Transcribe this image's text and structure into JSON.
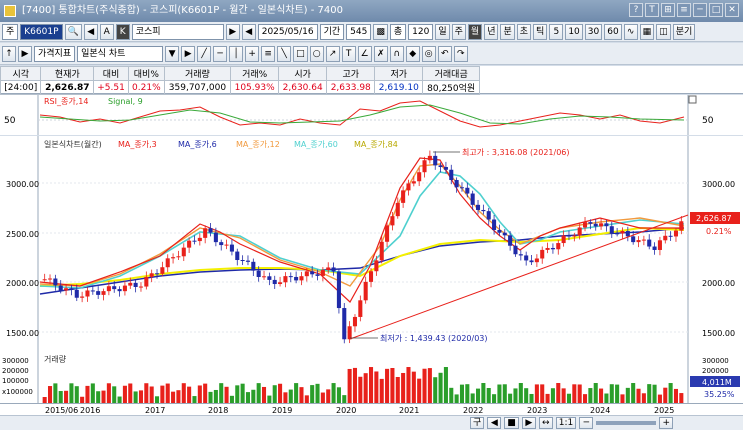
{
  "window": {
    "title": "[7400] 통합차트(주식종합) - 코스피(K6601P - 월간 - 일본식차트) - 7400",
    "buttons": [
      "?",
      "T",
      "⊞",
      "≡",
      "─",
      "□",
      "✕"
    ]
  },
  "toolbar1": {
    "code_prefix": "주",
    "code": "K6601P",
    "name": "코스피",
    "date": "2025/05/16",
    "period_label": "기간",
    "period_value": "545",
    "count_prefix": "총",
    "count_value": "120",
    "timeframes": [
      "일",
      "주",
      "월",
      "년",
      "분",
      "초",
      "틱",
      "5",
      "10",
      "30",
      "60"
    ],
    "active_timeframe": "월",
    "save_label": "분기"
  },
  "toolbar2": {
    "price_index": "가격지표",
    "chart_type": "일본식 차트"
  },
  "price_header": {
    "labels": [
      "시각",
      "현재가",
      "대비",
      "대비%",
      "거래량",
      "거래%",
      "시가",
      "고가",
      "저가",
      "거래대금"
    ],
    "values": [
      "[24:00]",
      "2,626.87",
      "+5.51",
      "0.21%",
      "359,707,000",
      "105.93%",
      "2,630.64",
      "2,633.98",
      "2,619.10",
      "80,250억원"
    ]
  },
  "rsi": {
    "title": "RSI_종가,14",
    "signal": "Signal, 9",
    "level": "50"
  },
  "main_chart": {
    "title": "일본식차트(월간)",
    "legend": [
      "MA_종가,3",
      "MA_종가,6",
      "MA_종가,12",
      "MA_종가,60",
      "MA_종가,84"
    ],
    "legend_colors": [
      "#e8211b",
      "#1f2aa8",
      "#f19a3e",
      "#4fd0cf",
      "#f4f000"
    ],
    "y_ticks": [
      "3000.00",
      "2500.00",
      "2000.00",
      "1500.00"
    ],
    "high_label": "최고가 : 3,316.08 (2021/06)",
    "low_label": "최저가 : 1,439.43 (2020/03)",
    "current_price": "2,626.87",
    "current_pct": "0.21%"
  },
  "volume": {
    "title": "거래량",
    "y_ticks": [
      "300000",
      "200000",
      "100000"
    ],
    "unit": "x100000",
    "value": "4,011M",
    "pct": "35.25%"
  },
  "x_axis": {
    "labels": [
      "2015/06",
      "2016",
      "2017",
      "2018",
      "2019",
      "2020",
      "2021",
      "2022",
      "2023",
      "2024",
      "2025"
    ]
  },
  "bottom": {
    "items": [
      "구",
      "◀",
      "■",
      "▶",
      "↔",
      "1:1",
      "─",
      "+"
    ]
  },
  "chart_data": {
    "type": "candlestick",
    "y_range": [
      1400,
      3400
    ],
    "points": [
      {
        "x": "2015/06",
        "y": 2074
      },
      {
        "x": "2016",
        "y": 1912
      },
      {
        "x": "2017",
        "y": 2026
      },
      {
        "x": "2018",
        "y": 2566
      },
      {
        "x": "2019",
        "y": 2041
      },
      {
        "x": "2020",
        "y": 2175
      },
      {
        "x": "2020/03",
        "y": 1439.43
      },
      {
        "x": "2021",
        "y": 2873
      },
      {
        "x": "2021/06",
        "y": 3316.08
      },
      {
        "x": "2022",
        "y": 2977
      },
      {
        "x": "2023",
        "y": 2236
      },
      {
        "x": "2024",
        "y": 2655
      },
      {
        "x": "2025",
        "y": 2399
      },
      {
        "x": "2025/05",
        "y": 2626.87
      }
    ]
  }
}
